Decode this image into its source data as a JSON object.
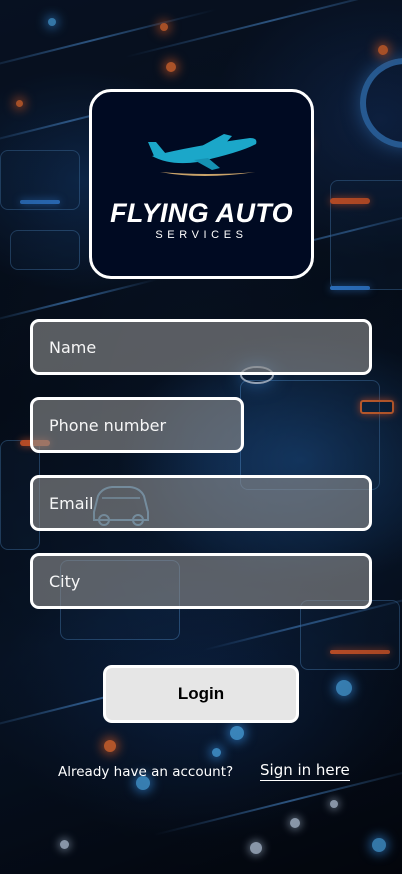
{
  "logo": {
    "title": "FLYING AUTO",
    "subtitle": "SERVICES",
    "icon": "airplane-icon",
    "plane_color": "#1ba7c9",
    "swoosh_color": "#c9a36a"
  },
  "form": {
    "name_placeholder": "Name",
    "phone_placeholder": "Phone number",
    "email_placeholder": "Email",
    "city_placeholder": "City",
    "login_label": "Login"
  },
  "footer": {
    "prompt": "Already have an account?",
    "link": "Sign in here"
  },
  "colors": {
    "field_bg": "#8c8c8c",
    "border": "#ffffff",
    "button_bg": "#e6e6e6",
    "logo_bg": "#000a22"
  }
}
